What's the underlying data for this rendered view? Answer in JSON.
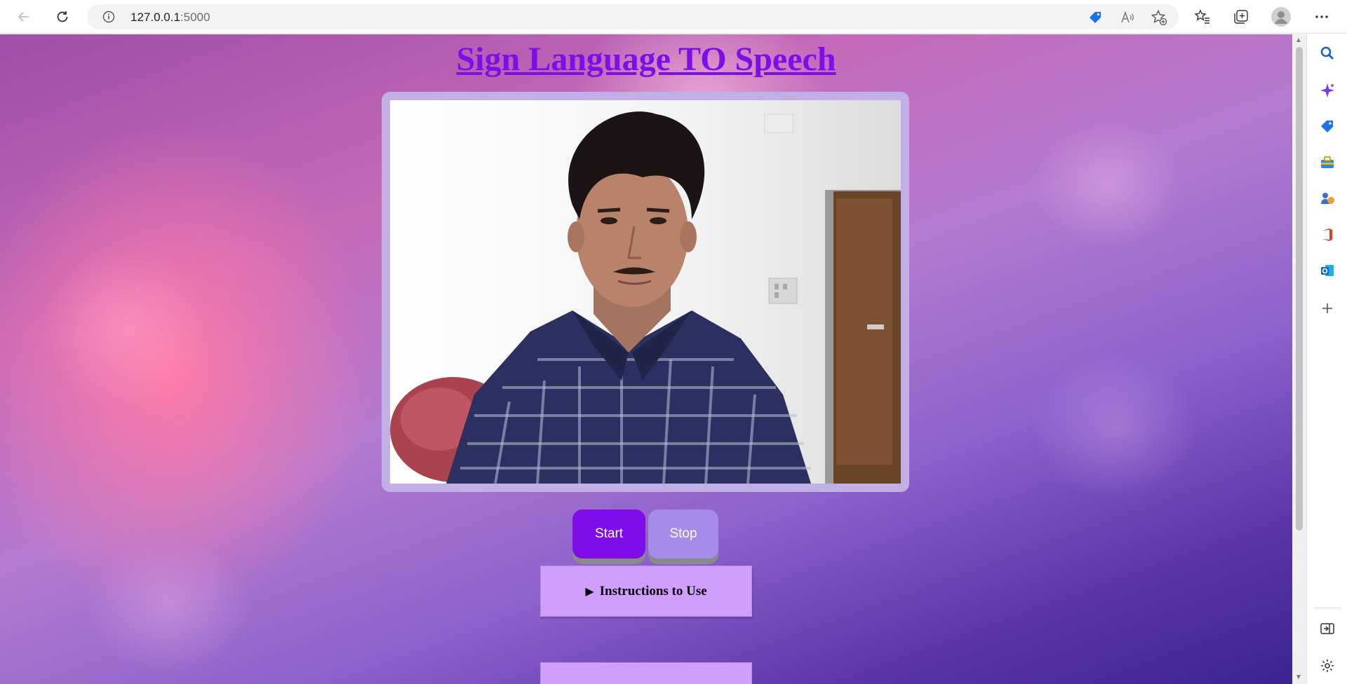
{
  "browser": {
    "url_host": "127.0.0.1",
    "url_port": ":5000",
    "icons": [
      "back-icon",
      "refresh-icon",
      "info-icon",
      "shopping-tag-icon",
      "read-aloud-icon",
      "add-favorite-icon",
      "favorites-icon",
      "collections-icon",
      "profile-icon",
      "more-icon"
    ],
    "sidebar_icons": [
      "search-icon",
      "copilot-icon",
      "shopping-icon",
      "tools-icon",
      "games-icon",
      "office-icon",
      "outlook-icon",
      "add-icon",
      "hide-sidebar-icon",
      "settings-icon"
    ]
  },
  "page": {
    "title": "Sign Language TO Speech",
    "start_label": "Start",
    "stop_label": "Stop",
    "instructions_label": "Instructions to Use",
    "colors": {
      "title": "#7e0de9",
      "start": "#7e0de9",
      "stop": "#a68ce8",
      "panel": "#d09ffd"
    }
  }
}
